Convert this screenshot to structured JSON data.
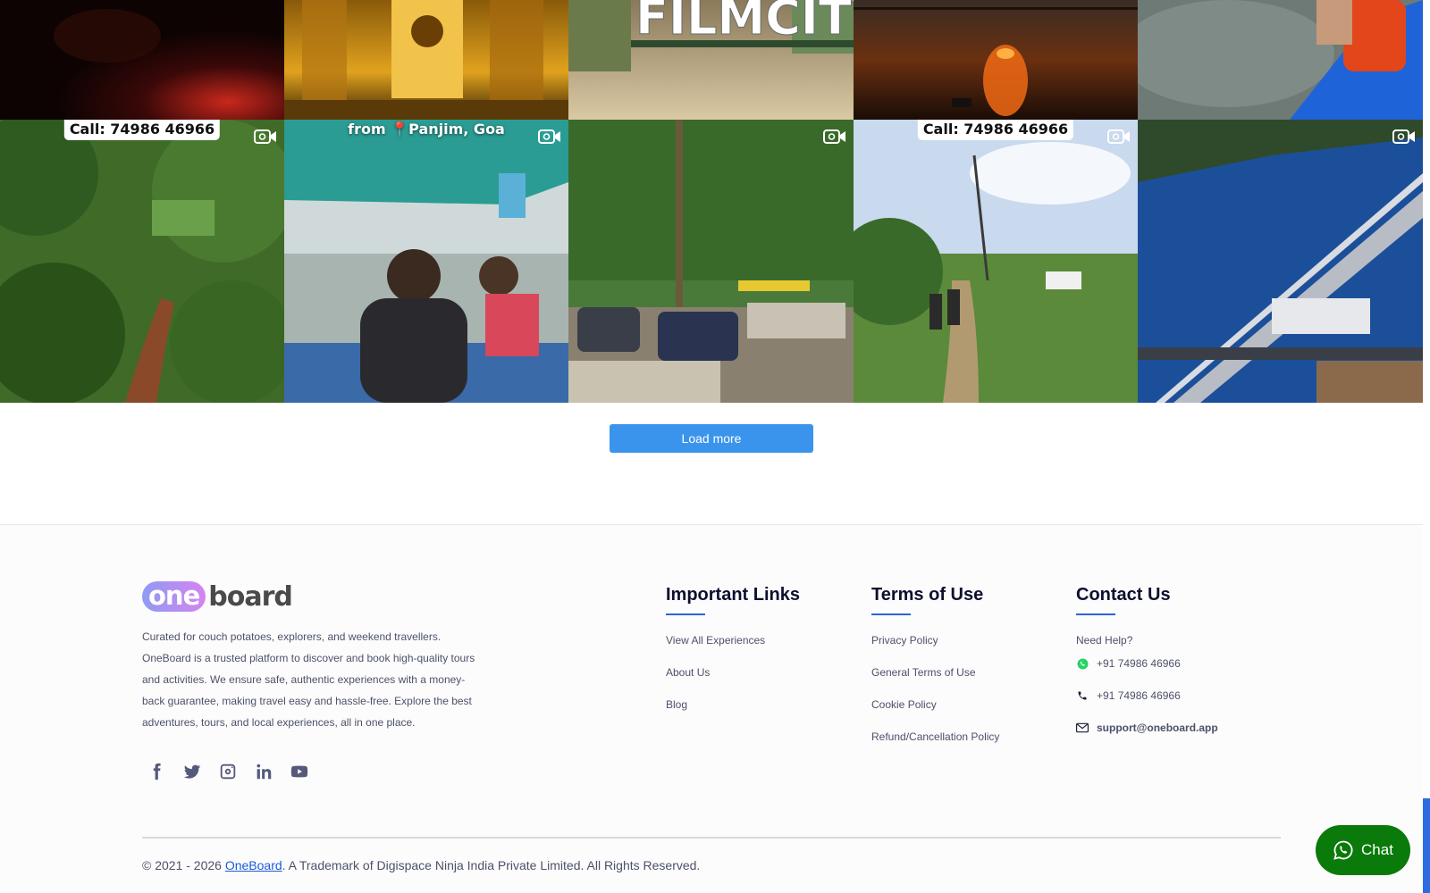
{
  "gallery": {
    "row1": [
      {
        "name": "dark-red-scene",
        "colors": [
          "#1a0505",
          "#c12a1e"
        ]
      },
      {
        "name": "golden-temple",
        "colors": [
          "#4a2f05",
          "#e2a41c"
        ]
      },
      {
        "name": "filmcity-sign",
        "colors": [
          "#7a6a4a",
          "#d8c6a0"
        ],
        "sign_text": "FILMCITY"
      },
      {
        "name": "sunset-river",
        "colors": [
          "#2a1a10",
          "#e86a1a"
        ]
      },
      {
        "name": "kayak-water",
        "colors": [
          "#5a6a6a",
          "#1f66d6"
        ]
      }
    ],
    "row2": [
      {
        "name": "jungle-trail-aerial",
        "tag": "Call: 74986 46966",
        "tag_style": "box"
      },
      {
        "name": "boat-ride",
        "tag": "from 📍Panjim, Goa",
        "tag_style": "plain"
      },
      {
        "name": "parking-crowd",
        "tag": "",
        "tag_style": "none"
      },
      {
        "name": "walk-path",
        "tag": "Call: 74986 46966",
        "tag_style": "box"
      },
      {
        "name": "bridge-aerial",
        "tag": "",
        "tag_style": "none"
      }
    ]
  },
  "load_more": {
    "label": "Load more"
  },
  "footer": {
    "logo_one": "one",
    "logo_board": "board",
    "about_text": "Curated for couch potatoes, explorers, and weekend travellers. OneBoard is a trusted platform to discover and book high-quality tours and activities. We ensure safe, authentic experiences with a money-back guarantee, making travel easy and hassle-free. Explore the best adventures, tours, and local experiences, all in one place.",
    "social": [
      "facebook-icon",
      "twitter-icon",
      "instagram-icon",
      "linkedin-icon",
      "youtube-icon"
    ],
    "important_links": {
      "title": "Important Links",
      "items": [
        "View All Experiences",
        "About Us",
        "Blog"
      ]
    },
    "terms": {
      "title": "Terms of Use",
      "items": [
        "Privacy Policy",
        "General Terms of Use",
        "Cookie Policy",
        "Refund/Cancellation Policy"
      ]
    },
    "contact": {
      "title": "Contact Us",
      "need_help": "Need Help?",
      "whatsapp": "+91 74986 46966",
      "phone": "+91 74986 46966",
      "email": "support@oneboard.app"
    },
    "copyright_prefix": "© 2021 - 2026 ",
    "copyright_link": "OneBoard",
    "copyright_suffix": ". A Trademark of Digispace Ninja India Private Limited. All Rights Reserved."
  },
  "chat": {
    "label": "Chat"
  },
  "colors": {
    "accent": "#3b94ec",
    "heading": "#0c0f2e",
    "underline": "#2c64d8",
    "chat_green": "#0a7a0a",
    "whatsapp_green": "#25d366"
  }
}
